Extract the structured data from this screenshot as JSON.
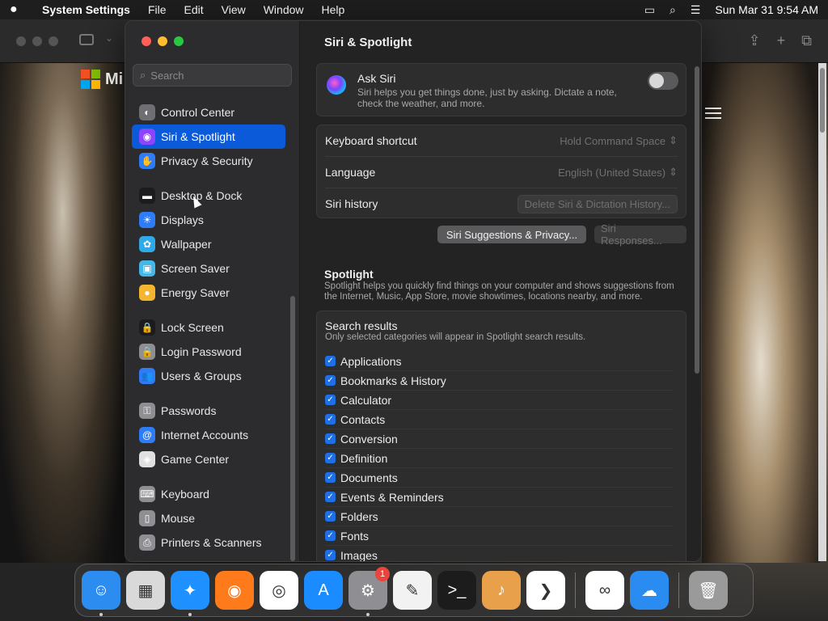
{
  "menubar": {
    "app_name": "System Settings",
    "menus": [
      "File",
      "Edit",
      "View",
      "Window",
      "Help"
    ],
    "clock": "Sun Mar 31  9:54 AM"
  },
  "background": {
    "logo_text": "Mi"
  },
  "search": {
    "placeholder": "Search"
  },
  "sidebar": {
    "items": [
      {
        "label": "Control Center",
        "icon": "control-center-icon",
        "color": "#6e6e73"
      },
      {
        "label": "Siri & Spotlight",
        "icon": "siri-icon",
        "color": "#8e44ff",
        "selected": true
      },
      {
        "label": "Privacy & Security",
        "icon": "hand-icon",
        "color": "#2e7cf6"
      },
      {
        "label": "Desktop & Dock",
        "icon": "dock-icon",
        "color": "#1c1c1e"
      },
      {
        "label": "Displays",
        "icon": "sun-icon",
        "color": "#2e7cf6"
      },
      {
        "label": "Wallpaper",
        "icon": "flower-icon",
        "color": "#31a8e8"
      },
      {
        "label": "Screen Saver",
        "icon": "screen-saver-icon",
        "color": "#44b6e8"
      },
      {
        "label": "Energy Saver",
        "icon": "bulb-icon",
        "color": "#f5b52e"
      },
      {
        "label": "Lock Screen",
        "icon": "lock-icon",
        "color": "#1c1c1e"
      },
      {
        "label": "Login Password",
        "icon": "lock-icon",
        "color": "#8e8e93"
      },
      {
        "label": "Users & Groups",
        "icon": "users-icon",
        "color": "#2e7cf6"
      },
      {
        "label": "Passwords",
        "icon": "key-icon",
        "color": "#8e8e93"
      },
      {
        "label": "Internet Accounts",
        "icon": "at-icon",
        "color": "#2e7cf6"
      },
      {
        "label": "Game Center",
        "icon": "game-center-icon",
        "color": "#e0e0e0"
      },
      {
        "label": "Keyboard",
        "icon": "keyboard-icon",
        "color": "#8e8e93"
      },
      {
        "label": "Mouse",
        "icon": "mouse-icon",
        "color": "#8e8e93"
      },
      {
        "label": "Printers & Scanners",
        "icon": "printer-icon",
        "color": "#8e8e93"
      }
    ]
  },
  "main": {
    "title": "Siri & Spotlight",
    "ask_siri": {
      "title": "Ask Siri",
      "desc": "Siri helps you get things done, just by asking. Dictate a note, check the weather, and more."
    },
    "keyboard_shortcut": {
      "label": "Keyboard shortcut",
      "value": "Hold Command Space"
    },
    "language": {
      "label": "Language",
      "value": "English (United States)"
    },
    "siri_history": {
      "label": "Siri history",
      "button": "Delete Siri & Dictation History..."
    },
    "buttons": {
      "suggestions": "Siri Suggestions & Privacy...",
      "responses": "Siri Responses..."
    },
    "spotlight": {
      "title": "Spotlight",
      "desc": "Spotlight helps you quickly find things on your computer and shows suggestions from the Internet, Music, App Store, movie showtimes, locations nearby, and more."
    },
    "search_results": {
      "title": "Search results",
      "desc": "Only selected categories will appear in Spotlight search results.",
      "items": [
        "Applications",
        "Bookmarks & History",
        "Calculator",
        "Contacts",
        "Conversion",
        "Definition",
        "Documents",
        "Events & Reminders",
        "Folders",
        "Fonts",
        "Images"
      ]
    }
  },
  "dock": {
    "badge": "1",
    "items": [
      {
        "name": "finder-icon",
        "color": "#2d8cf0"
      },
      {
        "name": "launchpad-icon",
        "color": "#d9d9d9"
      },
      {
        "name": "safari-icon",
        "color": "#1e90ff"
      },
      {
        "name": "firefox-icon",
        "color": "#ff7a1a"
      },
      {
        "name": "chrome-icon",
        "color": "#ffffff"
      },
      {
        "name": "app-store-icon",
        "color": "#1a8cff"
      },
      {
        "name": "system-settings-icon",
        "color": "#8e8e93"
      },
      {
        "name": "textedit-icon",
        "color": "#f2f2f2"
      },
      {
        "name": "terminal-icon",
        "color": "#1c1c1c"
      },
      {
        "name": "garageband-icon",
        "color": "#e8a04a"
      },
      {
        "name": "vscode-icon",
        "color": "#ffffff"
      },
      {
        "name": "visual-studio-icon",
        "color": "#ffffff"
      },
      {
        "name": "weather-icon",
        "color": "#2a8cf0"
      },
      {
        "name": "trash-icon",
        "color": "#9a9a9a"
      }
    ]
  }
}
